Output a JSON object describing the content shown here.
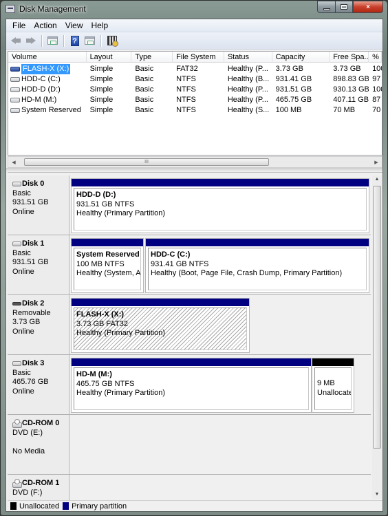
{
  "window": {
    "title": "Disk Management",
    "controls": {
      "minimize": "minimize",
      "maximize": "maximize",
      "close": "×"
    }
  },
  "menu": [
    "File",
    "Action",
    "View",
    "Help"
  ],
  "toolbar": {
    "buttons": [
      "back-icon",
      "forward-icon",
      "show-hide-console-tree-icon",
      "help-icon",
      "show-hide-action-pane-icon",
      "properties-icon"
    ],
    "help_glyph": "?"
  },
  "volume_list": {
    "columns": [
      "Volume",
      "Layout",
      "Type",
      "File System",
      "Status",
      "Capacity",
      "Free Spa...",
      "% F"
    ],
    "rows": [
      {
        "volume": "FLASH-X (X:)",
        "layout": "Simple",
        "type": "Basic",
        "fs": "FAT32",
        "status": "Healthy (P...",
        "capacity": "3.73 GB",
        "free": "3.73 GB",
        "pct": "100",
        "selected": true,
        "icon": "flash"
      },
      {
        "volume": "HDD-C (C:)",
        "layout": "Simple",
        "type": "Basic",
        "fs": "NTFS",
        "status": "Healthy (B...",
        "capacity": "931.41 GB",
        "free": "898.83 GB",
        "pct": "97",
        "selected": false,
        "icon": "disk"
      },
      {
        "volume": "HDD-D (D:)",
        "layout": "Simple",
        "type": "Basic",
        "fs": "NTFS",
        "status": "Healthy (P...",
        "capacity": "931.51 GB",
        "free": "930.13 GB",
        "pct": "100",
        "selected": false,
        "icon": "disk"
      },
      {
        "volume": "HD-M (M:)",
        "layout": "Simple",
        "type": "Basic",
        "fs": "NTFS",
        "status": "Healthy (P...",
        "capacity": "465.75 GB",
        "free": "407.11 GB",
        "pct": "87",
        "selected": false,
        "icon": "disk"
      },
      {
        "volume": "System Reserved",
        "layout": "Simple",
        "type": "Basic",
        "fs": "NTFS",
        "status": "Healthy (S...",
        "capacity": "100 MB",
        "free": "70 MB",
        "pct": "70",
        "selected": false,
        "icon": "disk"
      }
    ],
    "hscroll_grip": "III"
  },
  "disks": [
    {
      "name": "Disk 0",
      "type": "Basic",
      "size": "931.51 GB",
      "state": "Online",
      "icon": "disk",
      "partitions": [
        {
          "title": "HDD-D  (D:)",
          "line2": "931.51 GB NTFS",
          "line3": "Healthy (Primary Partition)",
          "kind": "primary"
        }
      ]
    },
    {
      "name": "Disk 1",
      "type": "Basic",
      "size": "931.51 GB",
      "state": "Online",
      "icon": "disk",
      "partitions": [
        {
          "title": "System Reserved",
          "line2": "100 MB NTFS",
          "line3": "Healthy (System, Act",
          "kind": "primary"
        },
        {
          "title": "HDD-C  (C:)",
          "line2": "931.41 GB NTFS",
          "line3": "Healthy (Boot, Page File, Crash Dump, Primary Partition)",
          "kind": "primary"
        }
      ]
    },
    {
      "name": "Disk 2",
      "type": "Removable",
      "size": "3.73 GB",
      "state": "Online",
      "icon": "removable",
      "partitions": [
        {
          "title": "FLASH-X  (X:)",
          "line2": "3.73 GB FAT32",
          "line3": "Healthy (Primary Partition)",
          "kind": "primary",
          "selected": true
        }
      ]
    },
    {
      "name": "Disk 3",
      "type": "Basic",
      "size": "465.76 GB",
      "state": "Online",
      "icon": "disk",
      "partitions": [
        {
          "title": "HD-M  (M:)",
          "line2": "465.75 GB NTFS",
          "line3": "Healthy (Primary Partition)",
          "kind": "primary"
        },
        {
          "title": "",
          "line2": "9 MB",
          "line3": "Unallocate",
          "kind": "unallocated"
        }
      ]
    },
    {
      "name": "CD-ROM 0",
      "type": "DVD (E:)",
      "size": "",
      "state": "No Media",
      "icon": "cdrom",
      "partitions": []
    },
    {
      "name": "CD-ROM 1",
      "type": "DVD (F:)",
      "size": "",
      "state": "",
      "icon": "cdrom",
      "partitions": []
    }
  ],
  "legend": [
    {
      "label": "Unallocated",
      "color": "#000000"
    },
    {
      "label": "Primary partition",
      "color": "#000080"
    }
  ],
  "colors": {
    "primary": "#000080",
    "unallocated": "#000000",
    "selection": "#3399ff"
  }
}
